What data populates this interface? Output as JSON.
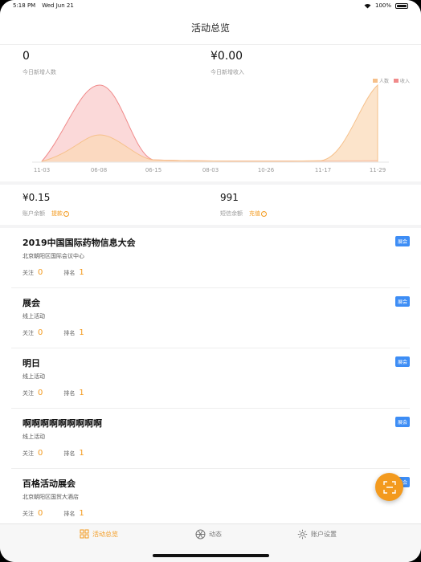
{
  "status_bar": {
    "time": "5:18 PM",
    "date": "Wed Jun 21",
    "battery": "100%"
  },
  "nav": {
    "title": "活动总览"
  },
  "overview": {
    "new_users_value": "0",
    "new_users_label": "今日新增人数",
    "new_income_value": "¥0.00",
    "new_income_label": "今日新增收入"
  },
  "chart_data": {
    "type": "area",
    "x": [
      "11-03",
      "06-08",
      "06-15",
      "08-03",
      "10-26",
      "11-17",
      "11-29"
    ],
    "series": [
      {
        "name": "人数",
        "color": "#f6c08a"
      },
      {
        "name": "收入",
        "color": "#f08a8a"
      }
    ],
    "legend": "top-right",
    "grid": false
  },
  "balances": {
    "account_value": "¥0.15",
    "account_label": "账户余额",
    "account_action": "提款",
    "sms_value": "991",
    "sms_label": "短信余额",
    "sms_action": "充值"
  },
  "list_labels": {
    "follow": "关注",
    "rank": "排名"
  },
  "events": [
    {
      "title": "2019中国国际药物信息大会",
      "location": "北京朝阳区国际会议中心",
      "follow": "0",
      "rank": "1",
      "badge": "展会"
    },
    {
      "title": "展会",
      "location": "线上活动",
      "follow": "0",
      "rank": "1",
      "badge": "展会"
    },
    {
      "title": "明日",
      "location": "线上活动",
      "follow": "0",
      "rank": "1",
      "badge": "展会"
    },
    {
      "title": "啊啊啊啊啊啊啊啊啊",
      "location": "线上活动",
      "follow": "0",
      "rank": "1",
      "badge": "展会"
    },
    {
      "title": "百格活动展会",
      "location": "北京朝阳区国贸大酒店",
      "follow": "0",
      "rank": "1",
      "badge": "展会"
    }
  ],
  "tabs": [
    {
      "label": "活动总览",
      "icon": "grid-icon"
    },
    {
      "label": "动态",
      "icon": "aperture-icon"
    },
    {
      "label": "账户设置",
      "icon": "gear-icon"
    }
  ],
  "colors": {
    "accent": "#f39a1e",
    "badge": "#3d8df5"
  }
}
